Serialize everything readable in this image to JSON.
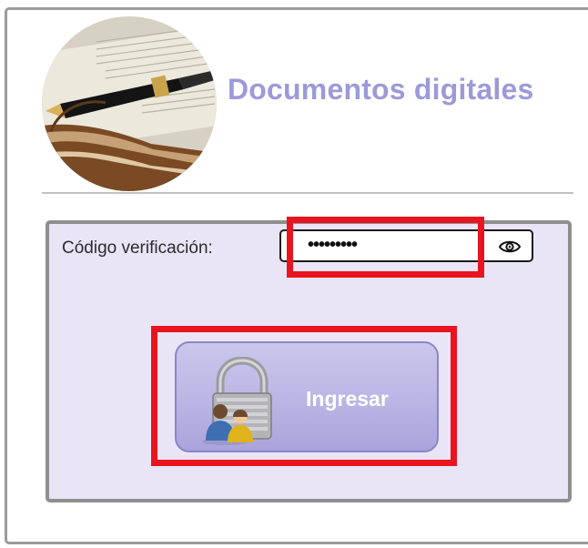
{
  "header": {
    "title": "Documentos digitales",
    "logo_icon": "book-pen-logo"
  },
  "form": {
    "code_label": "Código verificación:",
    "code_value": "•••••••••",
    "toggle_icon": "eye-icon",
    "submit_label": "Ingresar",
    "submit_icon": "lock-users-icon"
  },
  "colors": {
    "title": "#9c9ad8",
    "panel_background": "#e9e5f7",
    "button": "#bab5e4",
    "highlight": "#e8141f"
  }
}
